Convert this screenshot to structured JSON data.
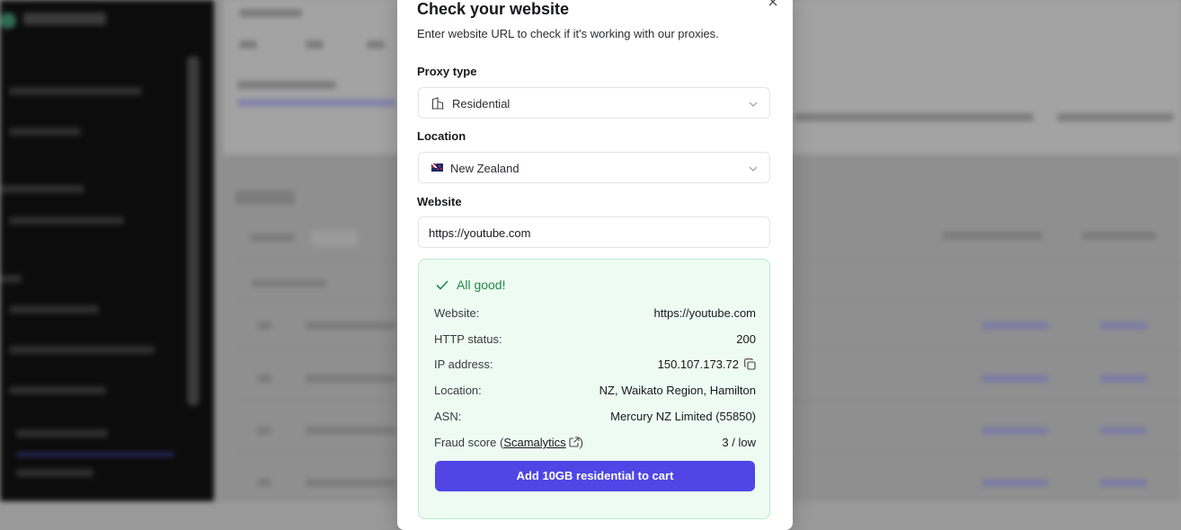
{
  "modal": {
    "title": "Check your website",
    "subtitle": "Enter website URL to check if it's working with our proxies.",
    "close_icon": "close-icon"
  },
  "form": {
    "proxy_type_label": "Proxy type",
    "proxy_type_value": "Residential",
    "proxy_type_icon": "building-icon",
    "location_label": "Location",
    "location_value": "New Zealand",
    "location_icon": "nz-flag-icon",
    "website_label": "Website",
    "website_value": "https://youtube.com"
  },
  "result": {
    "status_text": "All good!",
    "status_color": "#1f8a45",
    "rows": [
      {
        "label": "Website:",
        "value": "https://youtube.com"
      },
      {
        "label": "HTTP status:",
        "value": "200"
      },
      {
        "label": "IP address:",
        "value": "150.107.173.72"
      },
      {
        "label": "Location:",
        "value": "NZ, Waikato Region, Hamilton"
      },
      {
        "label": "ASN:",
        "value": "Mercury NZ Limited (55850)"
      }
    ],
    "fraud_label_prefix": "Fraud score (",
    "fraud_link": "Scamalytics",
    "fraud_label_suffix": ")",
    "fraud_value": "3 / low"
  },
  "cta": {
    "label": "Add 10GB residential to cart",
    "color": "#4f46e5"
  }
}
